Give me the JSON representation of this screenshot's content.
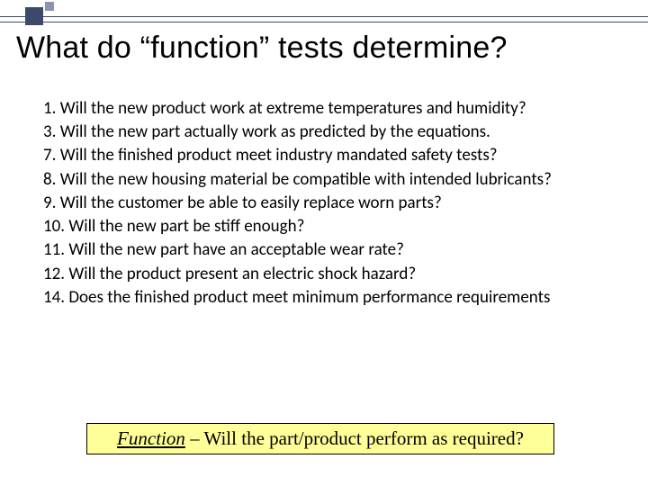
{
  "title": "What do “function” tests determine?",
  "items": [
    {
      "n": "1.",
      "text": "Will the new product work at extreme temperatures and humidity?"
    },
    {
      "n": "3.",
      "text": "Will the new part actually work as predicted by the equations."
    },
    {
      "n": "7.",
      "text": "Will the finished product meet industry mandated safety tests?"
    },
    {
      "n": "8.",
      "text": "Will the new housing material be compatible with intended lubricants?"
    },
    {
      "n": "9.",
      "text": "Will the customer be able to easily replace worn parts?"
    },
    {
      "n": "10.",
      "text": "Will the new part be stiff enough?"
    },
    {
      "n": "11.",
      "text": "Will the new part have an acceptable wear rate?"
    },
    {
      "n": "12.",
      "text": "Will the product present an electric shock hazard?"
    },
    {
      "n": "14.",
      "text": "Does the finished product meet minimum performance requirements"
    }
  ],
  "callout": {
    "lead": "Function",
    "rest": " – Will the part/product perform as required?"
  }
}
